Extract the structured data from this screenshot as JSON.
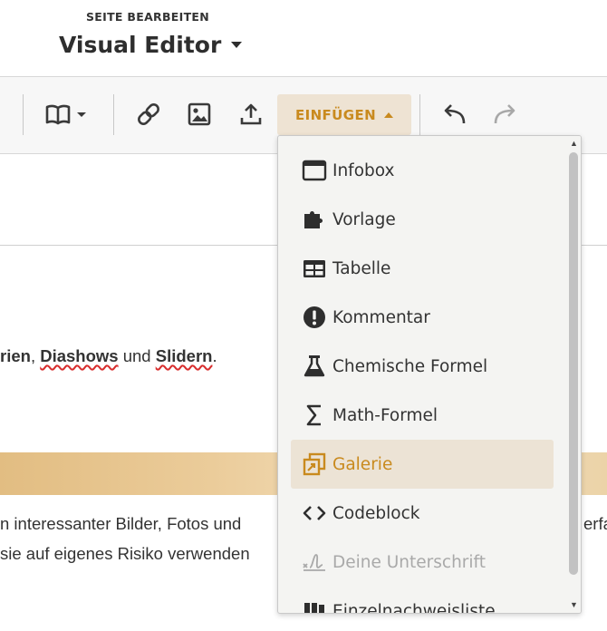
{
  "header": {
    "subtitle": "SEITE BEARBEITEN",
    "title": "Visual Editor"
  },
  "toolbar": {
    "insert_label": "EINFÜGEN",
    "icons": [
      "book-icon",
      "link-icon",
      "image-icon",
      "upload-icon",
      "undo-icon",
      "redo-icon"
    ]
  },
  "content": {
    "line1": {
      "part1": "rien",
      "sep1": ", ",
      "part2": "Diashows",
      "sep2": " und ",
      "part3": "Slidern",
      "end": "."
    },
    "line2": "n interessanter Bilder, Fotos und",
    "line3": "sie auf eigenes Risiko verwenden",
    "right_fragment": "erfa"
  },
  "menu": {
    "items": [
      {
        "label": "Infobox",
        "icon": "infobox-icon",
        "state": "normal"
      },
      {
        "label": "Vorlage",
        "icon": "puzzle-icon",
        "state": "normal"
      },
      {
        "label": "Tabelle",
        "icon": "table-icon",
        "state": "normal"
      },
      {
        "label": "Kommentar",
        "icon": "exclamation-icon",
        "state": "normal"
      },
      {
        "label": "Chemische Formel",
        "icon": "flask-icon",
        "state": "normal"
      },
      {
        "label": "Math-Formel",
        "icon": "sigma-icon",
        "state": "normal"
      },
      {
        "label": "Galerie",
        "icon": "gallery-icon",
        "state": "active"
      },
      {
        "label": "Codeblock",
        "icon": "code-icon",
        "state": "normal"
      },
      {
        "label": "Deine Unterschrift",
        "icon": "signature-icon",
        "state": "disabled"
      },
      {
        "label": "Einzelnachweisliste",
        "icon": "references-icon",
        "state": "normal"
      }
    ]
  },
  "colors": {
    "accent": "#c98a1e",
    "active_bg": "#ece3d5",
    "toolbar_bg": "#f7f7f7",
    "menu_bg": "#f4f4f2",
    "spell_underline": "#d82d2d"
  }
}
